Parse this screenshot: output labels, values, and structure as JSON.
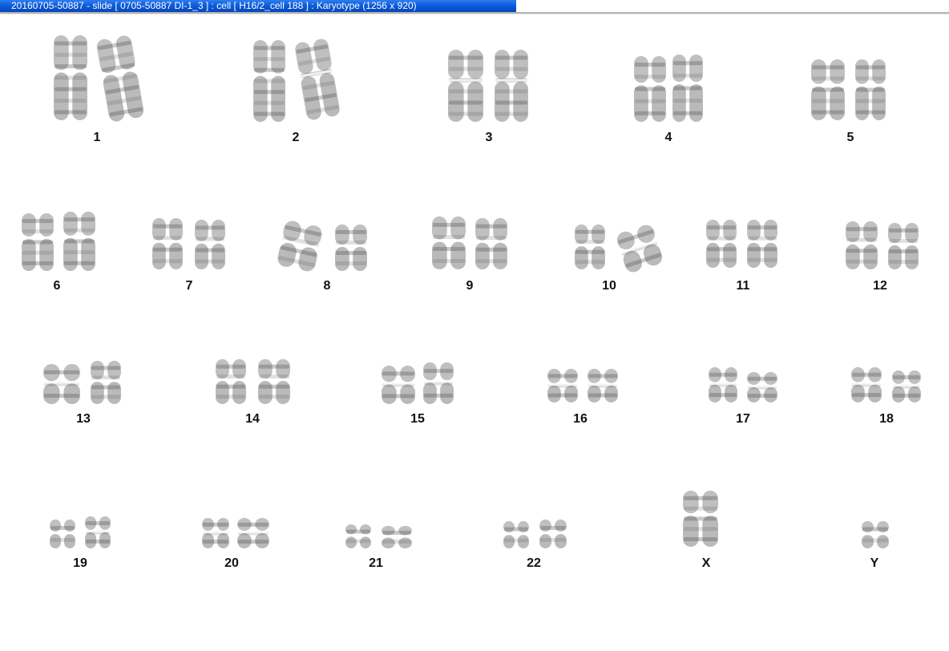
{
  "window": {
    "title": "20160705-50887 - slide [ 0705-50887 DI-1_3 ] : cell [ H16/2_cell 188 ] : Karyotype  (1256 x 920)"
  },
  "chromosomes": [
    {
      "label": "1"
    },
    {
      "label": "2"
    },
    {
      "label": "3"
    },
    {
      "label": "4"
    },
    {
      "label": "5"
    },
    {
      "label": "6"
    },
    {
      "label": "7"
    },
    {
      "label": "8"
    },
    {
      "label": "9"
    },
    {
      "label": "10"
    },
    {
      "label": "11"
    },
    {
      "label": "12"
    },
    {
      "label": "13"
    },
    {
      "label": "14"
    },
    {
      "label": "15"
    },
    {
      "label": "16"
    },
    {
      "label": "17"
    },
    {
      "label": "18"
    },
    {
      "label": "19"
    },
    {
      "label": "20"
    },
    {
      "label": "21"
    },
    {
      "label": "22"
    },
    {
      "label": "X"
    },
    {
      "label": "Y"
    }
  ],
  "colors": {
    "titlebar": "#0a5ad8",
    "chromatin": "#8c8c8c",
    "band": "#3c3c3c"
  }
}
